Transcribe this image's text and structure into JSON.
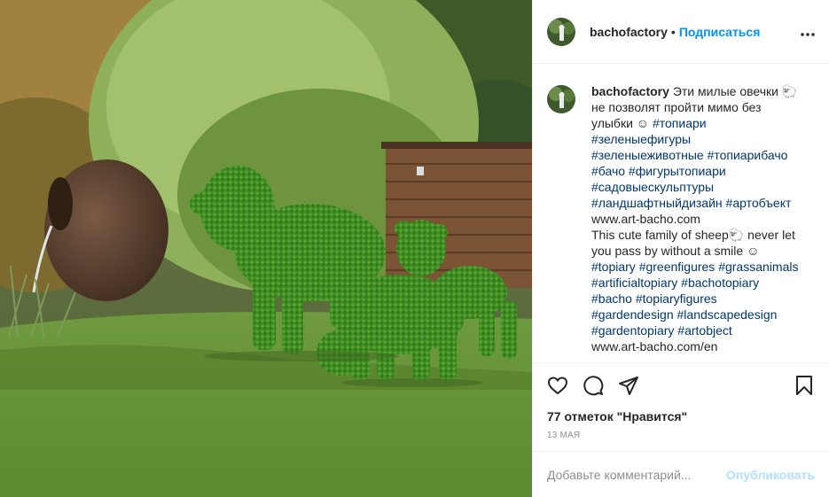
{
  "post": {
    "username": "bachofactory",
    "separator": "•",
    "follow_label": "Подписаться",
    "more_icon": "more-horizontal-icon",
    "caption_lines": [
      {
        "text": "Эти милые овечки 🐑",
        "type": "text"
      },
      {
        "text": "не позволят пройти мимо без",
        "type": "text"
      },
      {
        "text": "улыбки ☺ ",
        "type": "text",
        "tag": "#топиари"
      },
      {
        "text": "#зеленыефигуры",
        "type": "tag"
      },
      {
        "text": "#зеленыеживотные #топиарибачо",
        "type": "tag"
      },
      {
        "text": "#бачо #фигурытопиари",
        "type": "tag"
      },
      {
        "text": "#садовыескульптуры",
        "type": "tag"
      },
      {
        "text": "#ландшафтныйдизайн #артобъект",
        "type": "tag"
      },
      {
        "text": "www.art-bacho.com",
        "type": "link"
      },
      {
        "text": "This cute family of sheep🐑 never let",
        "type": "text"
      },
      {
        "text": "you pass by without a smile ☺",
        "type": "text"
      },
      {
        "text": "#topiary #greenfigures #grassanimals",
        "type": "tag"
      },
      {
        "text": "#artificialtopiary #bachotopiary",
        "type": "tag"
      },
      {
        "text": "#bacho #topiaryfigures",
        "type": "tag"
      },
      {
        "text": "#gardendesign #landscapedesign",
        "type": "tag"
      },
      {
        "text": "#gardentopiary #artobject",
        "type": "tag"
      },
      {
        "text": "www.art-bacho.com/en",
        "type": "link"
      }
    ],
    "likes_text": "77 отметок \"Нравится\"",
    "date_text": "13 МАЯ",
    "comment_placeholder": "Добавьте комментарий...",
    "publish_label": "Опубликовать",
    "icons": [
      "heart-icon",
      "comment-icon",
      "share-icon",
      "bookmark-icon"
    ]
  },
  "colors": {
    "follow": "#0095f6",
    "hashtag": "#00376b",
    "publish_disabled": "#b2dffc",
    "border": "#efefef"
  }
}
